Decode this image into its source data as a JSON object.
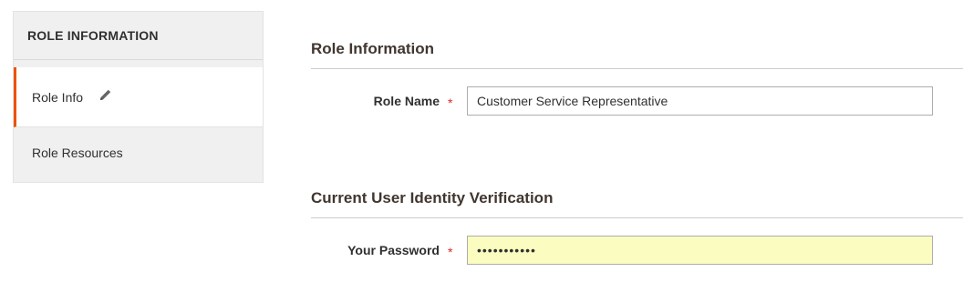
{
  "sidebar": {
    "title": "ROLE INFORMATION",
    "tabs": [
      {
        "label": "Role Info",
        "active": true,
        "icon": "pencil-icon"
      },
      {
        "label": "Role Resources",
        "active": false
      }
    ]
  },
  "role_info_section": {
    "title": "Role Information",
    "role_name": {
      "label": "Role Name",
      "required_mark": "*",
      "value": "Customer Service Representative"
    }
  },
  "verification_section": {
    "title": "Current User Identity Verification",
    "password": {
      "label": "Your Password",
      "required_mark": "*",
      "value": "•••••••••••"
    }
  },
  "colors": {
    "accent": "#eb5202",
    "required": "#e22626",
    "autofill": "#fafdbf"
  }
}
